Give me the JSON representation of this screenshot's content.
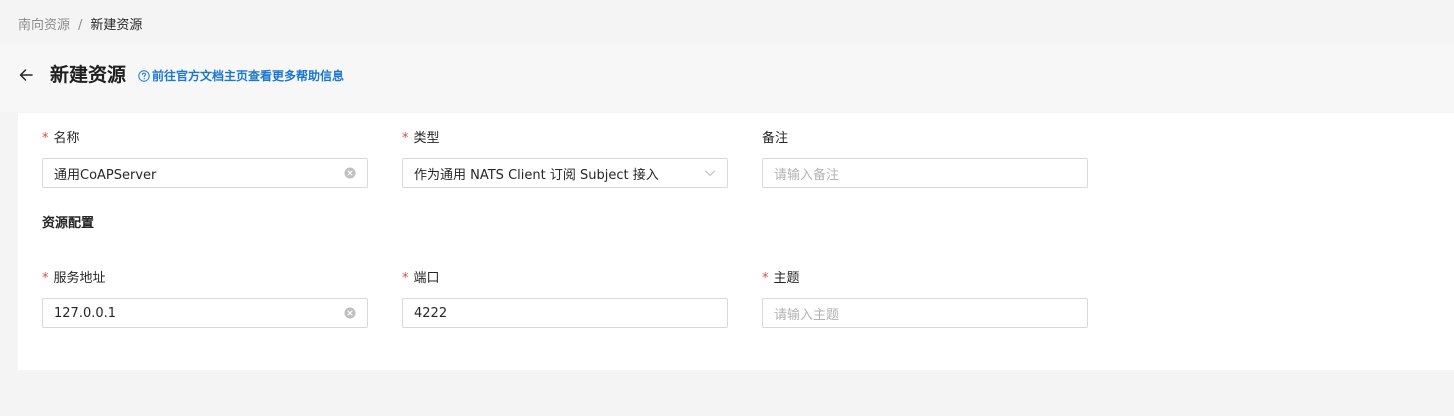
{
  "breadcrumb": {
    "parent": "南向资源",
    "separator": "/",
    "current": "新建资源"
  },
  "header": {
    "title": "新建资源",
    "help_link": "前往官方文档主页查看更多帮助信息"
  },
  "form": {
    "name": {
      "label": "名称",
      "value": "通用CoAPServer"
    },
    "type": {
      "label": "类型",
      "value": "作为通用 NATS Client 订阅 Subject 接入"
    },
    "remark": {
      "label": "备注",
      "placeholder": "请输入备注"
    },
    "section_title": "资源配置",
    "address": {
      "label": "服务地址",
      "value": "127.0.0.1"
    },
    "port": {
      "label": "端口",
      "value": "4222"
    },
    "topic": {
      "label": "主题",
      "placeholder": "请输入主题"
    }
  },
  "colors": {
    "accent": "#1b77d2",
    "required": "#e5484d",
    "background": "#f4f4f4",
    "card": "#ffffff"
  },
  "icons": {
    "back": "arrow-left-icon",
    "help": "question-circle-icon",
    "clear": "close-circle-icon",
    "dropdown": "chevron-down-icon"
  }
}
